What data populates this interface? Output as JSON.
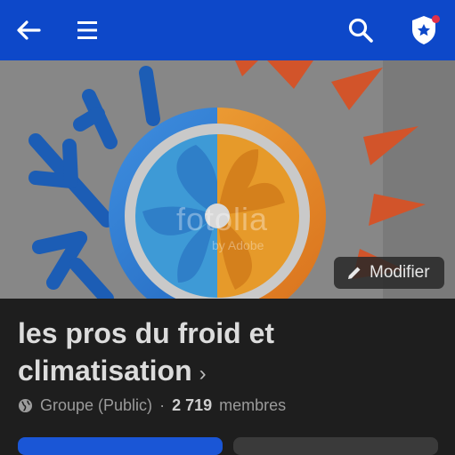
{
  "toolbar": {
    "back_icon": "arrow-left-icon",
    "menu_icon": "hamburger-icon",
    "search_icon": "search-icon",
    "shield_icon": "shield-star-icon",
    "accent": "#0d48c9",
    "notification_dot_color": "#e0304a"
  },
  "cover": {
    "watermark_main": "fotolia",
    "watermark_sub": "by Adobe",
    "edit_button_label": "Modifier"
  },
  "group": {
    "title": "les pros du froid et climatisation",
    "chevron": "›",
    "visibility": "Groupe (Public)",
    "separator": "·",
    "member_count": "2 719",
    "member_label": "membres"
  }
}
